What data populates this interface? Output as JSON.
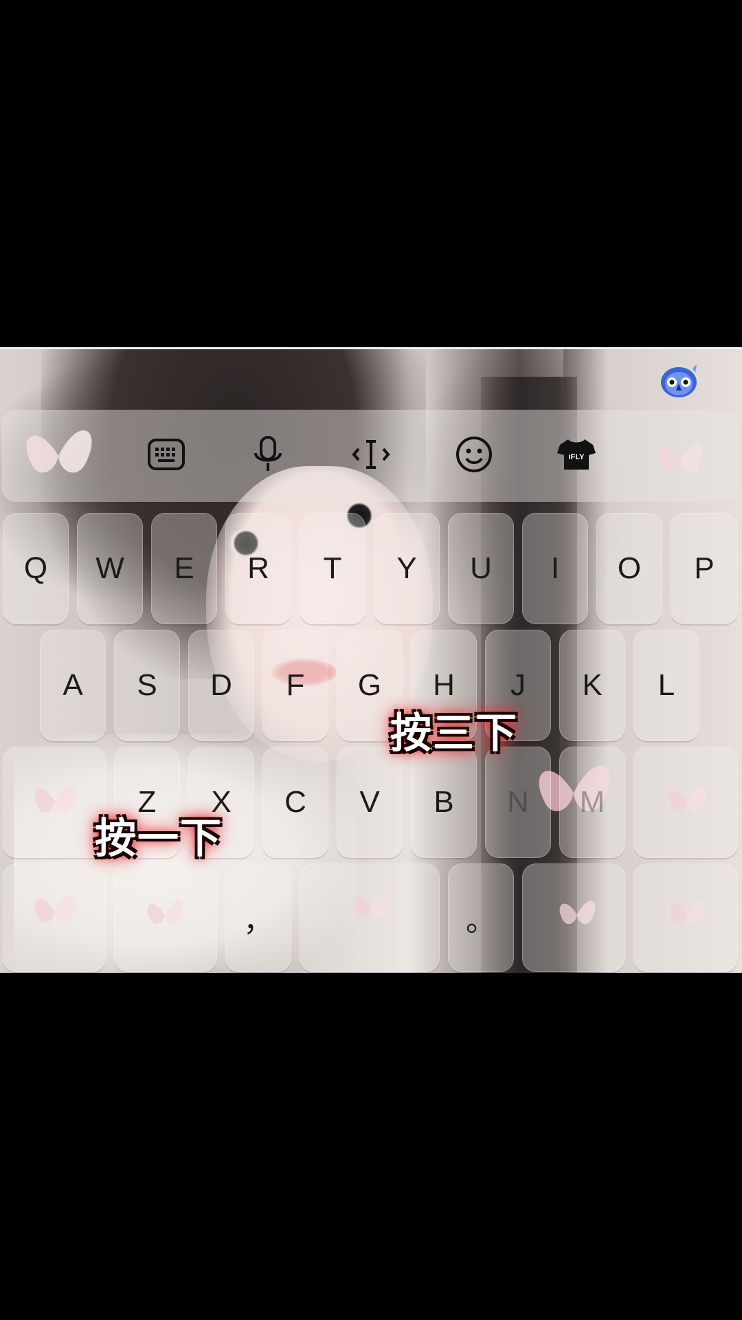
{
  "keyboard": {
    "toolbar": {
      "icons": [
        "keyboard-icon",
        "microphone-icon",
        "cursor-icon",
        "emoji-icon",
        "skin-shirt-icon"
      ],
      "skin_label": "iFLY"
    },
    "rows": [
      [
        "Q",
        "W",
        "E",
        "R",
        "T",
        "Y",
        "U",
        "I",
        "O",
        "P"
      ],
      [
        "A",
        "S",
        "D",
        "F",
        "G",
        "H",
        "J",
        "K",
        "L"
      ],
      [
        "",
        "Z",
        "X",
        "C",
        "V",
        "B",
        "N",
        "M",
        ""
      ],
      [
        "",
        "",
        "，",
        "",
        "。",
        "",
        ""
      ]
    ]
  },
  "overlay": {
    "text_one": "按一下",
    "text_three": "按三下"
  },
  "colors": {
    "overlay_glow": "#e0292f",
    "key_text": "#1b1b1b",
    "background": "#000000"
  }
}
